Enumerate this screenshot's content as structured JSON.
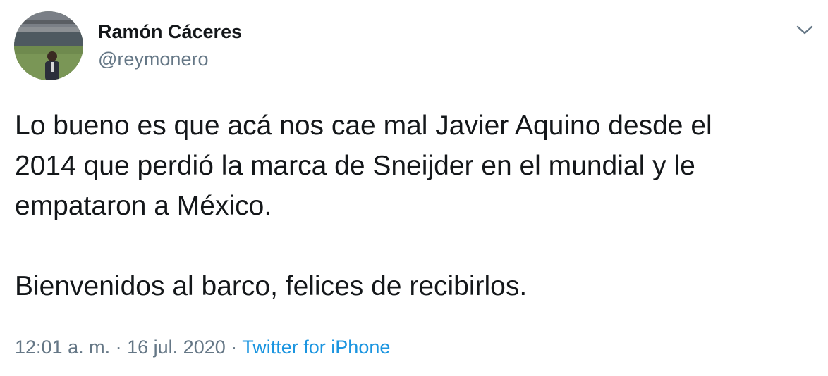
{
  "author": {
    "name": "Ramón Cáceres",
    "handle": "@reymonero",
    "avatar_icon": "profile-photo-stadium"
  },
  "menu": {
    "icon": "chevron-down-icon"
  },
  "tweet": {
    "line1": "Lo bueno es que acá nos cae mal Javier Aquino desde el",
    "line2": "2014 que perdió la marca de Sneijder en el mundial y le",
    "line3": "empataron a México.",
    "line4": "Bienvenidos al barco, felices de recibirlos."
  },
  "meta": {
    "time": "12:01 a. m.",
    "sep1": "·",
    "date": "16 jul. 2020",
    "sep2": "·",
    "source": "Twitter for iPhone"
  },
  "colors": {
    "text": "#14171a",
    "secondary": "#657786",
    "link": "#1b95e0"
  }
}
